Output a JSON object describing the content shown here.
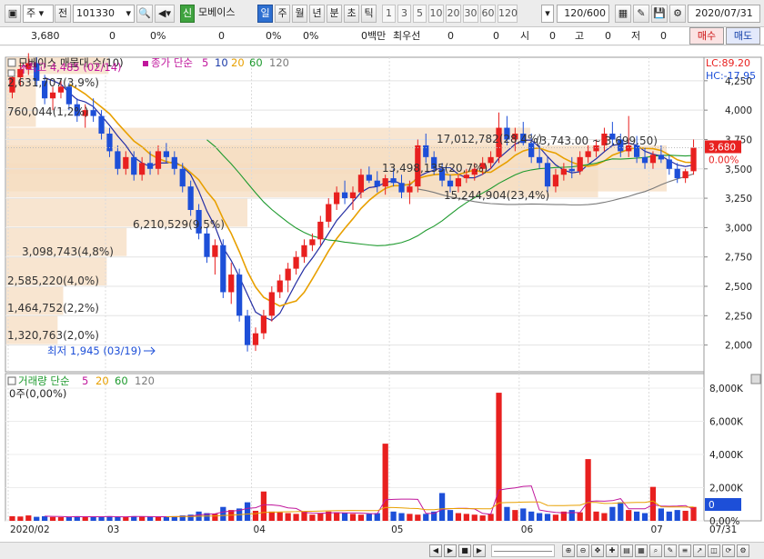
{
  "toolbar": {
    "mode": "주",
    "prev_label": "전",
    "stock_code": "101330",
    "stock_badge": "신",
    "stock_name": "모베이스",
    "periods": [
      "일",
      "주",
      "월",
      "년",
      "분",
      "초",
      "틱"
    ],
    "selected_period": "일",
    "intervals": [
      "1",
      "3",
      "5",
      "10",
      "20",
      "30",
      "60",
      "120"
    ],
    "count_value": "120",
    "count_total": "/600",
    "date": "2020/07/31"
  },
  "info": {
    "price": "3,680",
    "v1": "0",
    "p1": "0%",
    "v2": "0",
    "p2": "0%",
    "p3": "0%",
    "amount": "0백만",
    "best_label": "최우선",
    "best_a": "0",
    "best_b": "0",
    "open_label": "시",
    "open_val": "0",
    "high_label": "고",
    "high_val": "0",
    "low_label": "저",
    "low_val": "0",
    "buy": "매수",
    "sell": "매도"
  },
  "price_panel": {
    "title": "모베이스 매물대 수(10)",
    "ma_label": "종가 단순",
    "ma_periods": [
      "5",
      "10",
      "20",
      "60",
      "120"
    ],
    "lc": "LC:89.20",
    "hc": "HC:-17.95",
    "high_annot": "최고 4,485 (02/14)",
    "low_annot": "최저 1,945 (03/19)",
    "last_price": "3,680",
    "last_pct": "0.00%",
    "range_annot": "(3,743.00 ~ 3,699.50)",
    "y_ticks": [
      "4,250",
      "4,000",
      "3,750",
      "3,500",
      "3,250",
      "3,000",
      "2,750",
      "2,500",
      "2,250",
      "2,000"
    ],
    "vp_labels": [
      "2,631,707(3,9%)",
      "760,044(1,2%)",
      "13,498,135(20,7%)",
      "17,012,782(28,4%)",
      "15,244,904(23,4%)",
      "6,210,529(9,5%)",
      "3,098,743(4,8%)",
      "2,585,220(4,0%)",
      "1,464,752(2,2%)",
      "1,320,763(2,0%)"
    ]
  },
  "volume_panel": {
    "title": "거래량 단순",
    "ma_periods": [
      "5",
      "20",
      "60",
      "120"
    ],
    "current": "0주(0,00%)",
    "y_ticks": [
      "8,000K",
      "6,000K",
      "4,000K",
      "2,000K",
      "0,00%"
    ],
    "last_value": "0"
  },
  "x_axis": {
    "labels": [
      "2020/02",
      "03",
      "04",
      "05",
      "06",
      "07"
    ],
    "end_label": "07/31"
  },
  "colors": {
    "up": "#e8201f",
    "down": "#1d4fd8",
    "ma5": "#c0169c",
    "ma10": "#1a3aa8",
    "ma20": "#e8a000",
    "ma60": "#1e9a2e",
    "ma120": "#7a7a7a",
    "volume_profile": "#f5dcc0",
    "accent": "#2d6fd1"
  },
  "chart_data": {
    "type": "candlestick",
    "title": "모베이스 매물대 수(10)",
    "period": "daily",
    "date_range": [
      "2020/02",
      "2020/07/31"
    ],
    "ylim": [
      1850,
      4450
    ],
    "candles": [
      [
        4150,
        4300,
        4100,
        4280
      ],
      [
        4280,
        4400,
        4200,
        4350
      ],
      [
        4350,
        4485,
        4300,
        4400
      ],
      [
        4400,
        4450,
        4200,
        4250
      ],
      [
        4250,
        4300,
        4050,
        4100
      ],
      [
        4100,
        4200,
        4000,
        4150
      ],
      [
        4150,
        4250,
        4100,
        4200
      ],
      [
        4200,
        4230,
        4000,
        4050
      ],
      [
        4050,
        4100,
        3900,
        3950
      ],
      [
        3950,
        4050,
        3850,
        4000
      ],
      [
        4000,
        4100,
        3900,
        3950
      ],
      [
        3950,
        4000,
        3750,
        3800
      ],
      [
        3800,
        3850,
        3600,
        3650
      ],
      [
        3650,
        3700,
        3450,
        3500
      ],
      [
        3500,
        3650,
        3450,
        3600
      ],
      [
        3600,
        3650,
        3400,
        3450
      ],
      [
        3450,
        3600,
        3400,
        3550
      ],
      [
        3550,
        3650,
        3450,
        3500
      ],
      [
        3500,
        3700,
        3450,
        3650
      ],
      [
        3650,
        3720,
        3550,
        3600
      ],
      [
        3600,
        3650,
        3450,
        3500
      ],
      [
        3500,
        3550,
        3300,
        3350
      ],
      [
        3350,
        3400,
        3100,
        3150
      ],
      [
        3150,
        3200,
        2900,
        2950
      ],
      [
        2950,
        3000,
        2700,
        2750
      ],
      [
        2750,
        2900,
        2600,
        2850
      ],
      [
        2850,
        2900,
        2400,
        2450
      ],
      [
        2450,
        2700,
        2350,
        2600
      ],
      [
        2600,
        2650,
        2200,
        2250
      ],
      [
        2250,
        2300,
        1945,
        2000
      ],
      [
        2000,
        2150,
        1950,
        2100
      ],
      [
        2100,
        2300,
        2050,
        2250
      ],
      [
        2250,
        2500,
        2200,
        2450
      ],
      [
        2450,
        2600,
        2400,
        2550
      ],
      [
        2550,
        2700,
        2450,
        2650
      ],
      [
        2650,
        2800,
        2600,
        2750
      ],
      [
        2750,
        2900,
        2700,
        2850
      ],
      [
        2850,
        2950,
        2800,
        2900
      ],
      [
        2900,
        3100,
        2850,
        3050
      ],
      [
        3050,
        3250,
        3000,
        3200
      ],
      [
        3200,
        3350,
        3150,
        3300
      ],
      [
        3300,
        3400,
        3200,
        3250
      ],
      [
        3250,
        3350,
        3150,
        3300
      ],
      [
        3300,
        3500,
        3250,
        3450
      ],
      [
        3450,
        3520,
        3380,
        3400
      ],
      [
        3400,
        3480,
        3300,
        3350
      ],
      [
        3350,
        3450,
        3280,
        3420
      ],
      [
        3420,
        3500,
        3350,
        3380
      ],
      [
        3380,
        3450,
        3250,
        3300
      ],
      [
        3300,
        3400,
        3200,
        3350
      ],
      [
        3350,
        3750,
        3300,
        3700
      ],
      [
        3700,
        3800,
        3550,
        3600
      ],
      [
        3600,
        3650,
        3450,
        3500
      ],
      [
        3500,
        3550,
        3350,
        3400
      ],
      [
        3400,
        3450,
        3300,
        3350
      ],
      [
        3350,
        3450,
        3300,
        3420
      ],
      [
        3420,
        3500,
        3380,
        3450
      ],
      [
        3450,
        3550,
        3400,
        3500
      ],
      [
        3500,
        3600,
        3450,
        3550
      ],
      [
        3550,
        3650,
        3500,
        3600
      ],
      [
        3600,
        3980,
        3550,
        3850
      ],
      [
        3850,
        3950,
        3700,
        3750
      ],
      [
        3750,
        3850,
        3650,
        3800
      ],
      [
        3800,
        3900,
        3700,
        3720
      ],
      [
        3720,
        3800,
        3550,
        3600
      ],
      [
        3600,
        3700,
        3500,
        3550
      ],
      [
        3550,
        3600,
        3300,
        3350
      ],
      [
        3350,
        3500,
        3300,
        3450
      ],
      [
        3450,
        3550,
        3400,
        3500
      ],
      [
        3500,
        3600,
        3420,
        3480
      ],
      [
        3480,
        3650,
        3450,
        3600
      ],
      [
        3600,
        3700,
        3550,
        3650
      ],
      [
        3650,
        3750,
        3600,
        3700
      ],
      [
        3700,
        3850,
        3650,
        3800
      ],
      [
        3800,
        3900,
        3700,
        3750
      ],
      [
        3750,
        3800,
        3600,
        3650
      ],
      [
        3650,
        3950,
        3600,
        3700
      ],
      [
        3700,
        3780,
        3550,
        3600
      ],
      [
        3600,
        3680,
        3500,
        3550
      ],
      [
        3550,
        3650,
        3500,
        3620
      ],
      [
        3620,
        3700,
        3550,
        3580
      ],
      [
        3580,
        3620,
        3450,
        3500
      ],
      [
        3500,
        3550,
        3380,
        3420
      ],
      [
        3420,
        3500,
        3380,
        3480
      ],
      [
        3480,
        3750,
        3450,
        3680
      ]
    ],
    "volume_profile": [
      {
        "price_band": [
          4300,
          4450
        ],
        "volume": 2631707,
        "pct": 3.9
      },
      {
        "price_band": [
          3850,
          4300
        ],
        "volume": 760044,
        "pct": 1.2
      },
      {
        "price_band": [
          3450,
          3850
        ],
        "volume": 13498135,
        "pct": 20.7
      },
      {
        "price_band": [
          3300,
          3700
        ],
        "volume": 17012782,
        "pct": 28.4
      },
      {
        "price_band": [
          3250,
          3550
        ],
        "volume": 15244904,
        "pct": 23.4
      },
      {
        "price_band": [
          3000,
          3250
        ],
        "volume": 6210529,
        "pct": 9.5
      },
      {
        "price_band": [
          2750,
          3000
        ],
        "volume": 3098743,
        "pct": 4.8
      },
      {
        "price_band": [
          2500,
          2750
        ],
        "volume": 2585220,
        "pct": 4.0
      },
      {
        "price_band": [
          2250,
          2500
        ],
        "volume": 1464752,
        "pct": 2.2
      },
      {
        "price_band": [
          2000,
          2250
        ],
        "volume": 1320763,
        "pct": 2.0
      }
    ],
    "volume_ylim": [
      0,
      8600
    ],
    "volumes_k": [
      300,
      280,
      350,
      260,
      300,
      250,
      240,
      260,
      300,
      280,
      240,
      260,
      300,
      250,
      260,
      300,
      280,
      260,
      240,
      250,
      300,
      350,
      400,
      600,
      500,
      450,
      900,
      700,
      800,
      1200,
      650,
      1900,
      600,
      550,
      500,
      450,
      600,
      400,
      500,
      600,
      550,
      500,
      450,
      400,
      450,
      500,
      5000,
      600,
      500,
      450,
      400,
      450,
      600,
      1800,
      700,
      500,
      450,
      400,
      350,
      450,
      8300,
      900,
      700,
      800,
      600,
      500,
      450,
      400,
      600,
      700,
      550,
      4000,
      600,
      500,
      900,
      1200,
      700,
      600,
      500,
      2200,
      800,
      600,
      700,
      650,
      900
    ]
  }
}
